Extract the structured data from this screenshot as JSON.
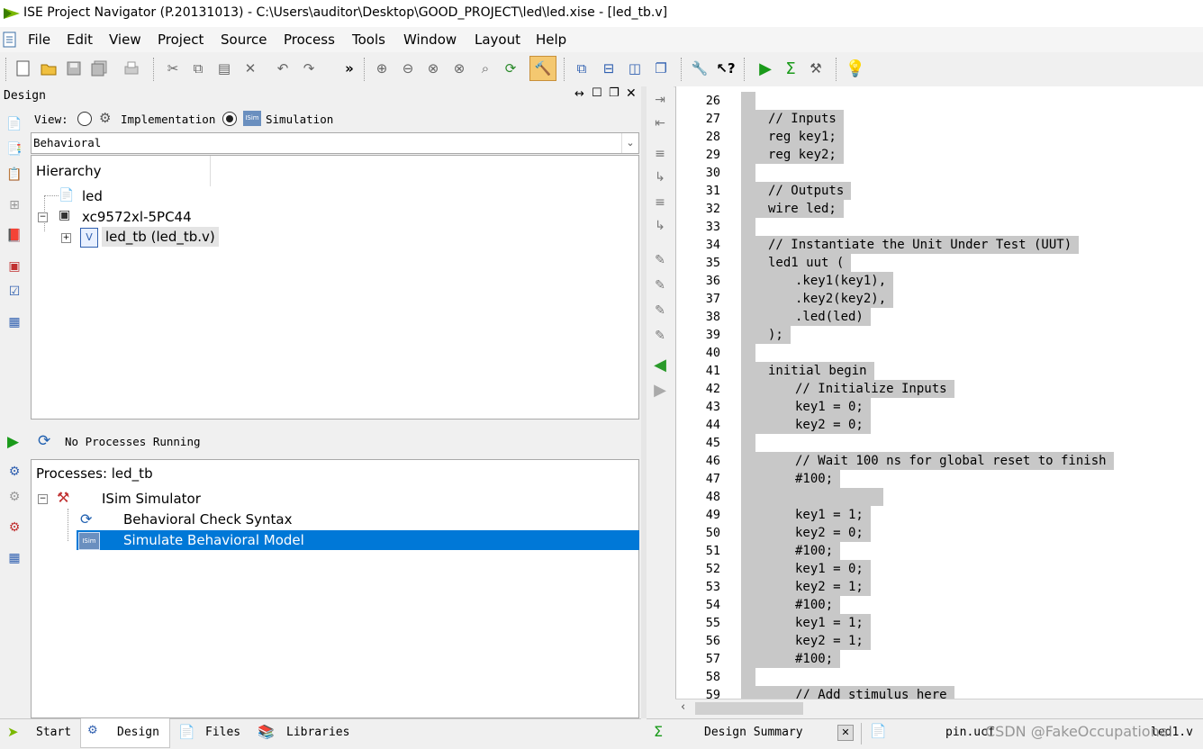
{
  "title": "ISE Project Navigator (P.20131013) - C:\\Users\\auditor\\Desktop\\GOOD_PROJECT\\led\\led.xise - [led_tb.v]",
  "menu": [
    "File",
    "Edit",
    "View",
    "Project",
    "Source",
    "Process",
    "Tools",
    "Window",
    "Layout",
    "Help"
  ],
  "design": {
    "header": "Design",
    "view_label": "View:",
    "implementation_label": "Implementation",
    "simulation_label": "Simulation",
    "behavioral": "Behavioral",
    "hierarchy_label": "Hierarchy",
    "tree": [
      "led",
      "xc9572xl-5PC44",
      "led_tb (led_tb.v)"
    ]
  },
  "processes": {
    "status": "No Processes Running",
    "title": "Processes: led_tb",
    "items": [
      "ISim Simulator",
      "Behavioral Check Syntax",
      "Simulate Behavioral Model"
    ]
  },
  "bottom_tabs": [
    "Start",
    "Design",
    "Files",
    "Libraries"
  ],
  "editor": {
    "lines": [
      {
        "n": "26",
        "code": ""
      },
      {
        "n": "27",
        "code": "\t// Inputs"
      },
      {
        "n": "28",
        "code": "\treg key1;"
      },
      {
        "n": "29",
        "code": "\treg key2;"
      },
      {
        "n": "30",
        "code": ""
      },
      {
        "n": "31",
        "code": "\t// Outputs"
      },
      {
        "n": "32",
        "code": "\twire led;"
      },
      {
        "n": "33",
        "code": ""
      },
      {
        "n": "34",
        "code": "\t// Instantiate the Unit Under Test (UUT)"
      },
      {
        "n": "35",
        "code": "\tled1 uut ("
      },
      {
        "n": "36",
        "code": "\t\t.key1(key1),"
      },
      {
        "n": "37",
        "code": "\t\t.key2(key2),"
      },
      {
        "n": "38",
        "code": "\t\t.led(led)"
      },
      {
        "n": "39",
        "code": "\t);"
      },
      {
        "n": "40",
        "code": ""
      },
      {
        "n": "41",
        "code": "\tinitial begin"
      },
      {
        "n": "42",
        "code": "\t\t// Initialize Inputs"
      },
      {
        "n": "43",
        "code": "\t\tkey1 = 0;"
      },
      {
        "n": "44",
        "code": "\t\tkey2 = 0;"
      },
      {
        "n": "45",
        "code": ""
      },
      {
        "n": "46",
        "code": "\t\t// Wait 100 ns for global reset to finish"
      },
      {
        "n": "47",
        "code": "\t\t#100;"
      },
      {
        "n": "48",
        "code": "\t\t"
      },
      {
        "n": "49",
        "code": "\t\tkey1 = 1;"
      },
      {
        "n": "50",
        "code": "\t\tkey2 = 0;"
      },
      {
        "n": "51",
        "code": "\t\t#100;"
      },
      {
        "n": "52",
        "code": "\t\tkey1 = 0;"
      },
      {
        "n": "53",
        "code": "\t\tkey2 = 1;"
      },
      {
        "n": "54",
        "code": "\t\t#100;"
      },
      {
        "n": "55",
        "code": "\t\tkey1 = 1;"
      },
      {
        "n": "56",
        "code": "\t\tkey2 = 1;"
      },
      {
        "n": "57",
        "code": "\t\t#100;"
      },
      {
        "n": "58",
        "code": ""
      },
      {
        "n": "59",
        "code": "\t\t// Add stimulus here"
      }
    ]
  },
  "editor_tabs": {
    "design_summary": "Design Summary",
    "pin": "pin.ucf",
    "led1": "led1.v",
    "watermark": "CSDN @FakeOccupational"
  }
}
